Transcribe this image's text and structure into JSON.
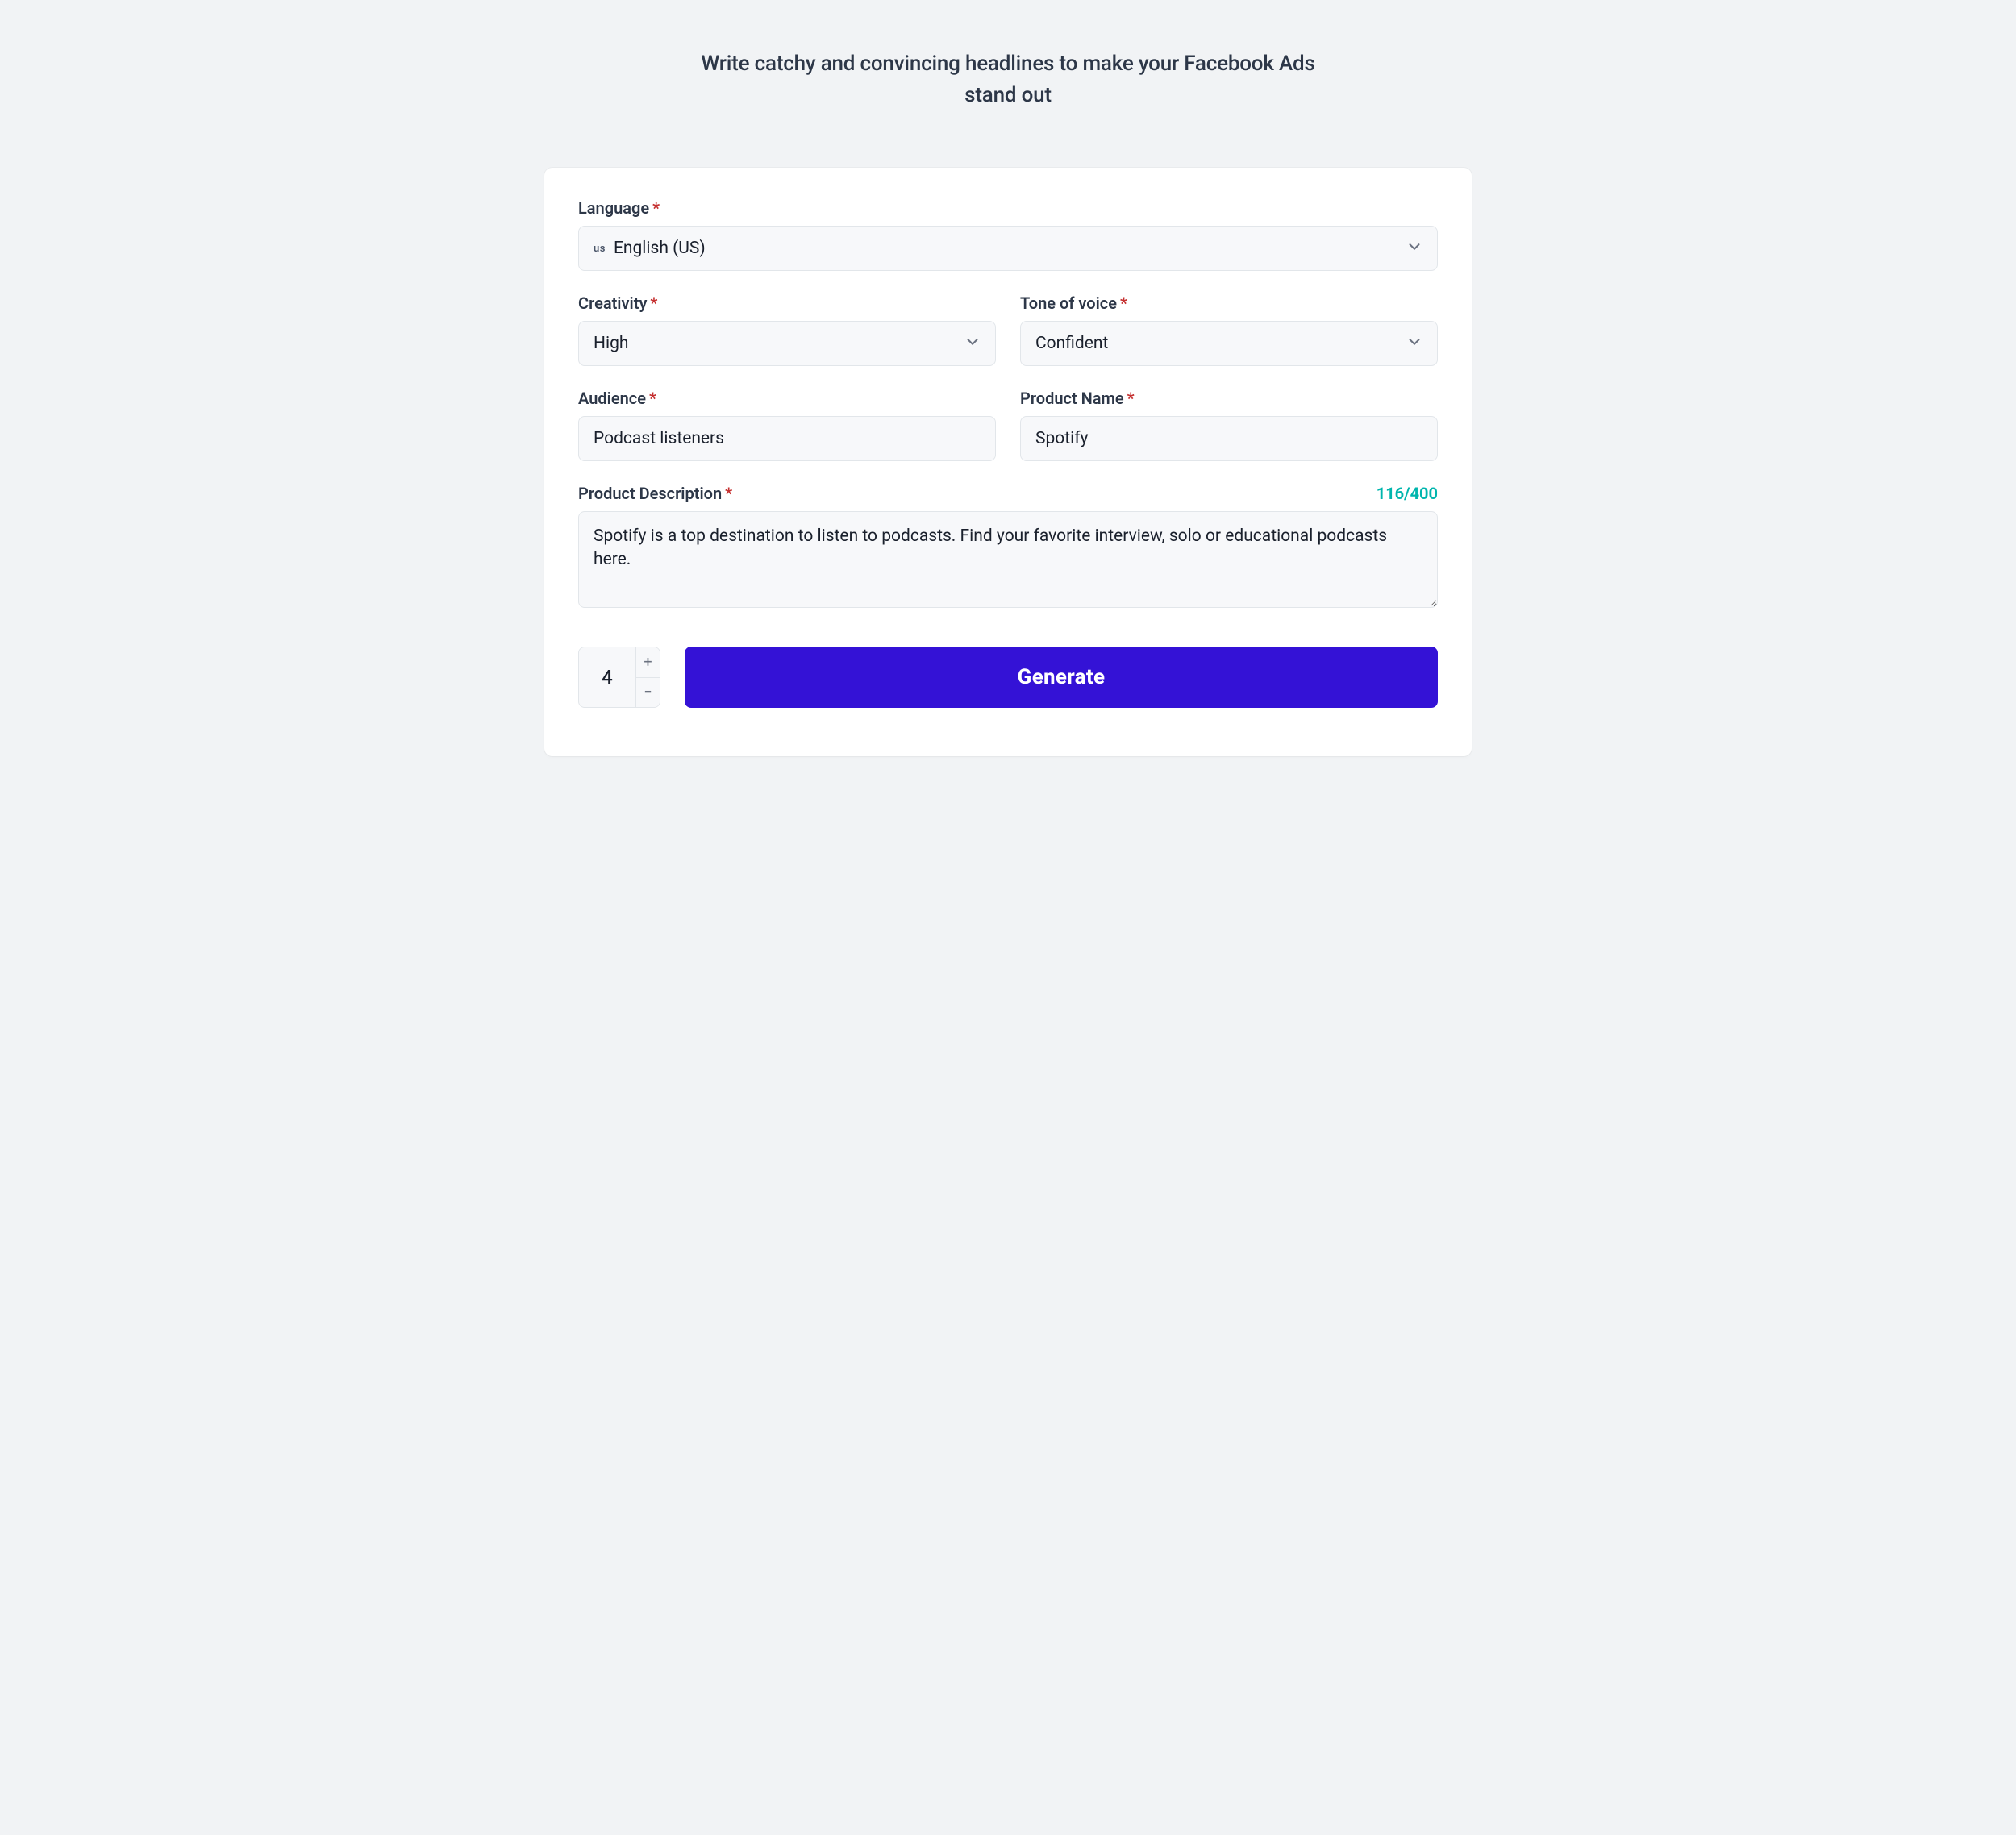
{
  "header": {
    "title": "Write catchy and convincing headlines to make your Facebook Ads stand out"
  },
  "form": {
    "language": {
      "label": "Language",
      "flag": "us",
      "value": "English (US)"
    },
    "creativity": {
      "label": "Creativity",
      "value": "High"
    },
    "tone": {
      "label": "Tone of voice",
      "value": "Confident"
    },
    "audience": {
      "label": "Audience",
      "value": "Podcast listeners"
    },
    "product_name": {
      "label": "Product Name",
      "value": "Spotify"
    },
    "description": {
      "label": "Product Description",
      "counter": "116/400",
      "value": "Spotify is a top destination to listen to podcasts. Find your favorite interview, solo or educational podcasts here."
    }
  },
  "action": {
    "quantity": "4",
    "generate_label": "Generate"
  }
}
